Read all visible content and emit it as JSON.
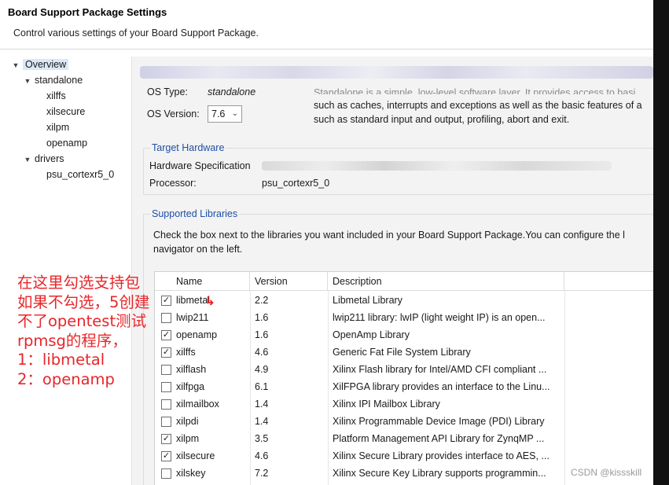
{
  "dialog": {
    "title": "Board Support Package Settings",
    "subtitle": "Control various settings of your Board Support Package."
  },
  "tree": [
    {
      "label": "Overview",
      "arrow": "▼",
      "indent": 0,
      "selected": true
    },
    {
      "label": "standalone",
      "arrow": "▼",
      "indent": 1
    },
    {
      "label": "xilffs",
      "arrow": "",
      "indent": 2
    },
    {
      "label": "xilsecure",
      "arrow": "",
      "indent": 2
    },
    {
      "label": "xilpm",
      "arrow": "",
      "indent": 2
    },
    {
      "label": "openamp",
      "arrow": "",
      "indent": 2
    },
    {
      "label": "drivers",
      "arrow": "▼",
      "indent": 1
    },
    {
      "label": "psu_cortexr5_0",
      "arrow": "",
      "indent": 2
    }
  ],
  "overview": {
    "os_type_label": "OS Type:",
    "os_type_value": "standalone",
    "os_version_label": "OS Version:",
    "os_version_value": "7.6",
    "description_line1": "Standalone is a simple, low-level software layer. It provides access to basi",
    "description_line2": "such as caches, interrupts and exceptions as well as the basic features of a",
    "description_line3": "such as standard input and output, profiling, abort and exit."
  },
  "target_hardware": {
    "title": "Target Hardware",
    "hw_spec_label": "Hardware Specification",
    "processor_label": "Processor:",
    "processor_value": "psu_cortexr5_0"
  },
  "supported_libraries": {
    "title": "Supported Libraries",
    "instructions_line1": "Check the box next to the libraries you want included in your Board Support Package.You can configure the l",
    "instructions_line2": "navigator on the left.",
    "columns": {
      "name": "Name",
      "version": "Version",
      "description": "Description"
    },
    "rows": [
      {
        "name": "libmetal",
        "version": "2.2",
        "description": "Libmetal Library",
        "checked": true
      },
      {
        "name": "lwip211",
        "version": "1.6",
        "description": "lwip211 library: lwIP (light weight IP) is an open...",
        "checked": false
      },
      {
        "name": "openamp",
        "version": "1.6",
        "description": "OpenAmp Library",
        "checked": true
      },
      {
        "name": "xilffs",
        "version": "4.6",
        "description": "Generic Fat File System Library",
        "checked": true
      },
      {
        "name": "xilflash",
        "version": "4.9",
        "description": "Xilinx Flash library for Intel/AMD CFI compliant ...",
        "checked": false
      },
      {
        "name": "xilfpga",
        "version": "6.1",
        "description": "XilFPGA library provides an interface to the Linu...",
        "checked": false
      },
      {
        "name": "xilmailbox",
        "version": "1.4",
        "description": "Xilinx IPI Mailbox Library",
        "checked": false
      },
      {
        "name": "xilpdi",
        "version": "1.4",
        "description": "Xilinx Programmable Device Image (PDI) Library",
        "checked": false
      },
      {
        "name": "xilpm",
        "version": "3.5",
        "description": "Platform Management API Library for ZynqMP ...",
        "checked": true
      },
      {
        "name": "xilsecure",
        "version": "4.6",
        "description": "Xilinx Secure Library provides interface to AES, ...",
        "checked": true
      },
      {
        "name": "xilskey",
        "version": "7.2",
        "description": "Xilinx Secure Key Library supports programmin...",
        "checked": false
      }
    ]
  },
  "annotation": {
    "lines": [
      "在这里勾选支持包",
      "如果不勾选，5创建",
      "不了opentest测试",
      "rpmsg的程序，",
      "1：libmetal",
      "2：openamp"
    ],
    "color": "#e8262b"
  },
  "watermark": "CSDN @kissskill"
}
